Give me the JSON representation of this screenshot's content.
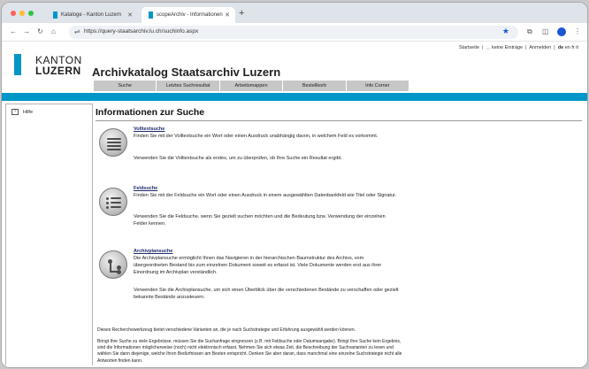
{
  "browser": {
    "tabs": [
      {
        "label": "Kataloge - Kanton Luzern",
        "active": false
      },
      {
        "label": "scopeArchiv - Informationen",
        "active": true
      }
    ],
    "new_tab": "+",
    "url": "https://query-staatsarchiv.lu.ch/suchinfo.aspx",
    "icons": {
      "back": "←",
      "forward": "→",
      "reload": "↻",
      "home": "⌂",
      "site_info": "⇌",
      "bookmark": "★",
      "extensions": "⧉",
      "sidebar": "◫",
      "menu": "⋮"
    }
  },
  "header": {
    "top_links": {
      "start": "Startseite",
      "entries": "keine Einträge",
      "login": "Anmelden",
      "lang_de": "de",
      "lang_en": "en",
      "lang_fr": "fr",
      "lang_it": "it"
    },
    "logo_line1": "KANTON",
    "logo_line2": "LUZERN",
    "title": "Archivkatalog Staatsarchiv Luzern",
    "menu": [
      {
        "label": "Suche"
      },
      {
        "label": "Letztes Suchresultat"
      },
      {
        "label": "Arbeitsmappen"
      },
      {
        "label": "Bestellkorb"
      },
      {
        "label": "Info Corner"
      }
    ]
  },
  "sidebar": {
    "items": [
      {
        "label": "Hilfe",
        "icon": "help-icon"
      }
    ]
  },
  "main": {
    "title": "Informationen zur Suche",
    "sections": [
      {
        "title": "Volltextsuche",
        "p1": "Finden Sie mit der Volltextsuche ein Wort oder einen Ausdruck unabhängig davon, in welchem Feld es vorkommt.",
        "p2": "Verwenden Sie die Volltextsuche als erstes, um zu überprüfen, ob Ihre Suche ein Resultat ergibt.",
        "icon": "fulltext-search-icon"
      },
      {
        "title": "Feldsuche",
        "p1": "Finden Sie mit der Feldsuche ein Wort oder einen Ausdruck in einem ausgewählten Datenbankfeld wie Titel oder Signatur.",
        "p2": "Verwenden Sie die Feldsuche, wenn Sie gezielt suchen möchten und die Bedeutung bzw. Verwendung der einzelnen Felder kennen.",
        "icon": "field-search-icon"
      },
      {
        "title": "Archivplansuche",
        "p1": "Die Archivplansuche ermöglicht Ihnen das Navigieren in der hierarchischen Baumstruktur des Archivs, vom übergeordneten Bestand bis zum einzelnen Dokument soweit es erfasst ist. Viele Dokumente werden erst aus ihrer Einordnung im Archivplan verständlich.",
        "p2": "Verwenden Sie die Archivplansuche, um sich einen Überblick über die verschiedenen Bestände zu verschaffen oder gezielt bekannte Bestände anzusteuern.",
        "icon": "archive-plan-icon"
      }
    ],
    "footer_p1": "Dieses Recherchewerkzeug bietet verschiedene Varianten an, die je nach Suchstrategie und Erfahrung ausgewählt werden können.",
    "footer_p2": "Bringt Ihre Suche zu viele Ergebnisse, müssen Sie die Suchanfrage eingrenzen (z.B. mit Feldsuche oder Datumsangabe). Bringt Ihre Suche kein Ergebnis, sind die Informationen möglicherweise (noch) nicht elektronisch erfasst. Nehmen Sie sich etwas Zeit, die Beschreibung der Suchvarianten zu lesen und wählen Sie dann diejenige, welche Ihren Bedürfnissen am Besten entspricht. Denken Sie aber daran, dass manchmal eine einzelne Suchstrategie nicht alle Antworten finden kann."
  },
  "colors": {
    "accent": "#0097c8",
    "menu_bg": "#c7c7c7",
    "link": "#1f2a6b"
  }
}
